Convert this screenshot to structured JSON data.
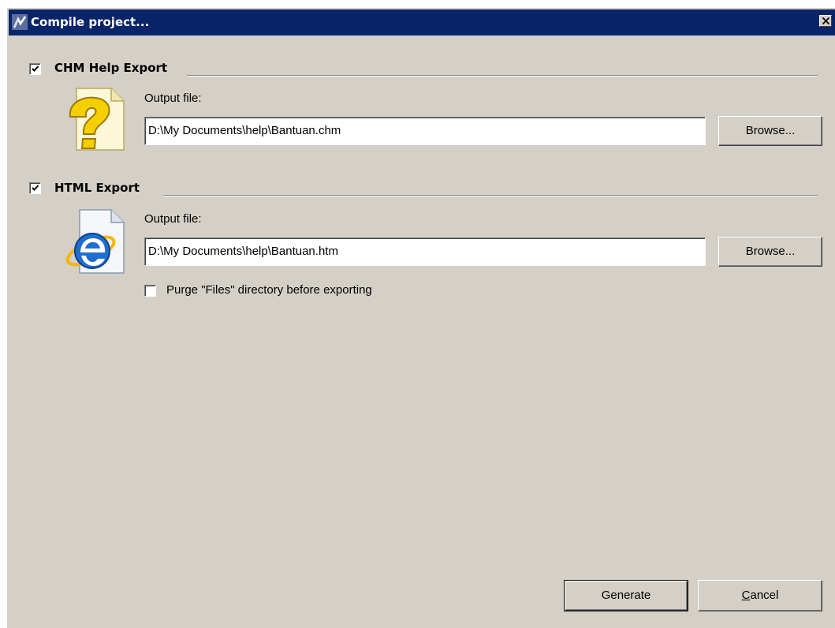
{
  "window": {
    "title": "Compile project...",
    "title_icon": "app-logo-icon",
    "close_icon": "close-icon"
  },
  "chm_section": {
    "checked": true,
    "label": "CHM Help Export",
    "icon": "help-file-icon",
    "output_label": "Output file:",
    "output_value": "D:\\My Documents\\help\\Bantuan.chm",
    "browse_label": "Browse..."
  },
  "html_section": {
    "checked": true,
    "label": "HTML Export",
    "icon": "internet-explorer-file-icon",
    "output_label": "Output file:",
    "output_value": "D:\\My Documents\\help\\Bantuan.htm",
    "browse_label": "Browse...",
    "purge_checked": false,
    "purge_label": "Purge \"Files\" directory before exporting"
  },
  "footer": {
    "generate_label": "Generate",
    "cancel_label": "Cancel",
    "cancel_mnemonic": "C",
    "cancel_rest": "ancel"
  },
  "colors": {
    "titlebar": "#0a246a",
    "face": "#d4d0c8",
    "chm_icon_yellow": "#f5d000",
    "ie_icon_blue": "#1f6fd1"
  }
}
